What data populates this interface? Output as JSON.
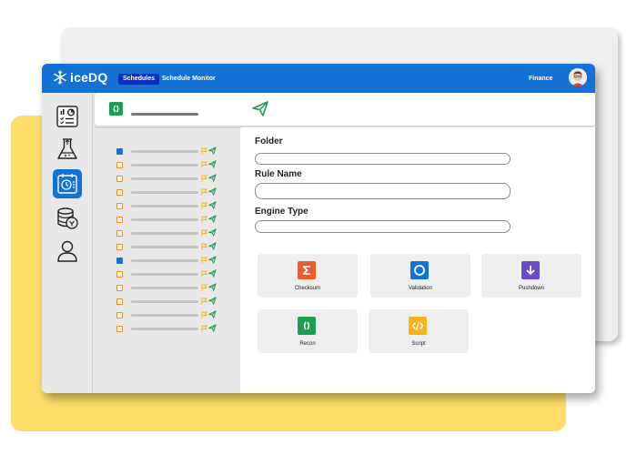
{
  "app": {
    "logo_text": "iceDQ",
    "tabs": [
      {
        "label": "Schedules",
        "active": true
      },
      {
        "label": "Schedule Monitor",
        "active": false
      }
    ],
    "user_label": "Finance"
  },
  "sidebar": {
    "items": [
      {
        "name": "dashboard-icon",
        "active": false
      },
      {
        "name": "lab-flask-icon",
        "active": false
      },
      {
        "name": "schedule-clock-icon",
        "active": true
      },
      {
        "name": "database-icon",
        "active": false
      },
      {
        "name": "user-icon",
        "active": false
      }
    ]
  },
  "list": {
    "rows": [
      {
        "checked": true
      },
      {
        "checked": false
      },
      {
        "checked": false
      },
      {
        "checked": false
      },
      {
        "checked": false
      },
      {
        "checked": false
      },
      {
        "checked": false
      },
      {
        "checked": false
      },
      {
        "checked": true
      },
      {
        "checked": false
      },
      {
        "checked": false
      },
      {
        "checked": false
      },
      {
        "checked": false
      },
      {
        "checked": false
      }
    ]
  },
  "form": {
    "folder_label": "Folder",
    "rule_name_label": "Rule Name",
    "engine_type_label": "Engine Type"
  },
  "rule_types": [
    {
      "label": "Checksum",
      "icon": "sigma-icon",
      "color": "#f0592a"
    },
    {
      "label": "Validation",
      "icon": "circle-icon",
      "color": "#1472d6"
    },
    {
      "label": "Pushdown",
      "icon": "arrow-down-icon",
      "color": "#6a4bc7"
    },
    {
      "label": "Recon",
      "icon": "recon-icon",
      "color": "#1e9e50"
    },
    {
      "label": "Script",
      "icon": "code-icon",
      "color": "#f7b318"
    }
  ],
  "colors": {
    "topbar": "#1472d6",
    "active_tab": "#0a2ec0",
    "backdrop_yellow": "#fedd6b",
    "backdrop_gray": "#efefef"
  }
}
